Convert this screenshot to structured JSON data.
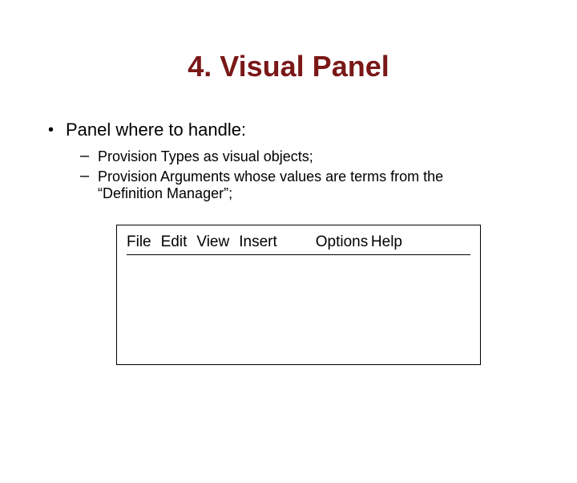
{
  "title": "4. Visual Panel",
  "bullet1": "Panel where to handle:",
  "sub1": "Provision Types as visual objects;",
  "sub2a": "Provision Arguments whose values are terms from the",
  "sub2b": "“Definition Manager”;",
  "menu": {
    "file": "File",
    "edit": "Edit",
    "view": "View",
    "insert": "Insert",
    "options": "Options",
    "help": "Help"
  }
}
